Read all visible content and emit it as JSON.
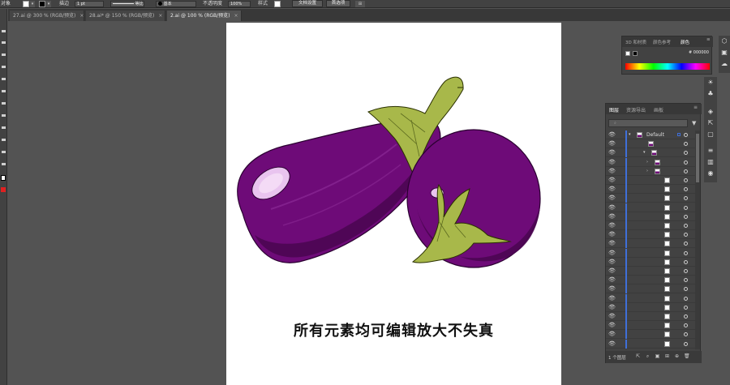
{
  "control_bar": {
    "label_left": "对象",
    "stroke_label": "描边",
    "stroke_width": "1 pt",
    "stroke_profile": "等比",
    "brush_label": "基本",
    "opacity_label": "不透明度",
    "opacity_value": "100%",
    "style_label": "样式",
    "doc_setup_button": "文档设置",
    "prefs_button": "首选项"
  },
  "tabs": [
    {
      "label": "27.ai @ 300 % (RGB/预览)",
      "close": "×"
    },
    {
      "label": "28.ai* @ 150 % (RGB/预览)",
      "close": "×"
    },
    {
      "label": "2.ai @ 100 % (RGB/预览)",
      "close": "×"
    }
  ],
  "artboard": {
    "caption": "所有元素均可编辑放大不失真"
  },
  "color_panel": {
    "tabs": [
      "3D 和材质",
      "颜色参考",
      "颜色"
    ],
    "active_tab": "颜色",
    "hex_prefix": "#",
    "hex_value": "000000"
  },
  "layers_panel": {
    "tabs": [
      "图层",
      "资源导出",
      "画板"
    ],
    "active_tab": "图层",
    "search_placeholder": "",
    "top_layer_name": "Default",
    "count_text": "1 个图层"
  },
  "colors": {
    "accent_blue": "#3f6fd8",
    "eggplant": "#6e0b78",
    "eggplant_dark": "#4b0552",
    "stem_green": "#a8b84a",
    "highlight": "#e9c4ef"
  }
}
